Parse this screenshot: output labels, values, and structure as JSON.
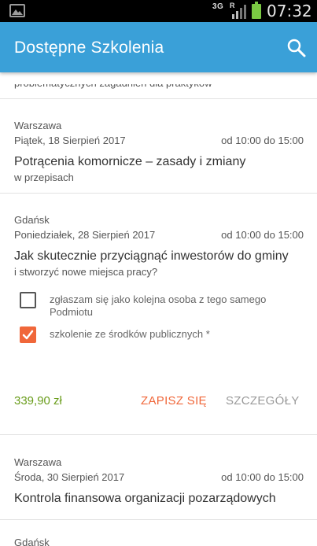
{
  "status_bar": {
    "network": "3G",
    "roaming": "R",
    "time": "07:32"
  },
  "app_bar": {
    "title": "Dostępne Szkolenia",
    "search_icon": "search-icon"
  },
  "previous_item_tail": "problematycznych zagadnień dla praktyków",
  "trainings": [
    {
      "city": "Warszawa",
      "date": "Piątek, 18 Sierpień 2017",
      "time": "od 10:00 do 15:00",
      "title": "Potrącenia komornicze – zasady i zmiany",
      "subtitle": "w przepisach"
    },
    {
      "city": "Gdańsk",
      "date": "Poniedziałek, 28 Sierpień 2017",
      "time": "od 10:00 do 15:00",
      "title": "Jak skutecznie przyciągnąć inwestorów do gminy",
      "subtitle": "i stworzyć nowe miejsca pracy?",
      "options": [
        {
          "label": "zgłaszam się jako kolejna osoba z tego samego Podmiotu",
          "checked": false
        },
        {
          "label": "szkolenie ze środków publicznych *",
          "checked": true
        }
      ],
      "price": "339,90 zł",
      "signup_label": "ZAPISZ SIĘ",
      "details_label": "SZCZEGÓŁY"
    },
    {
      "city": "Warszawa",
      "date": "Środa, 30 Sierpień 2017",
      "time": "od 10:00 do 15:00",
      "title": "Kontrola finansowa organizacji pozarządowych"
    },
    {
      "city": "Gdańsk"
    }
  ],
  "colors": {
    "app_bar": "#3aa0d8",
    "accent": "#f0673a",
    "price": "#6a9d1c"
  }
}
